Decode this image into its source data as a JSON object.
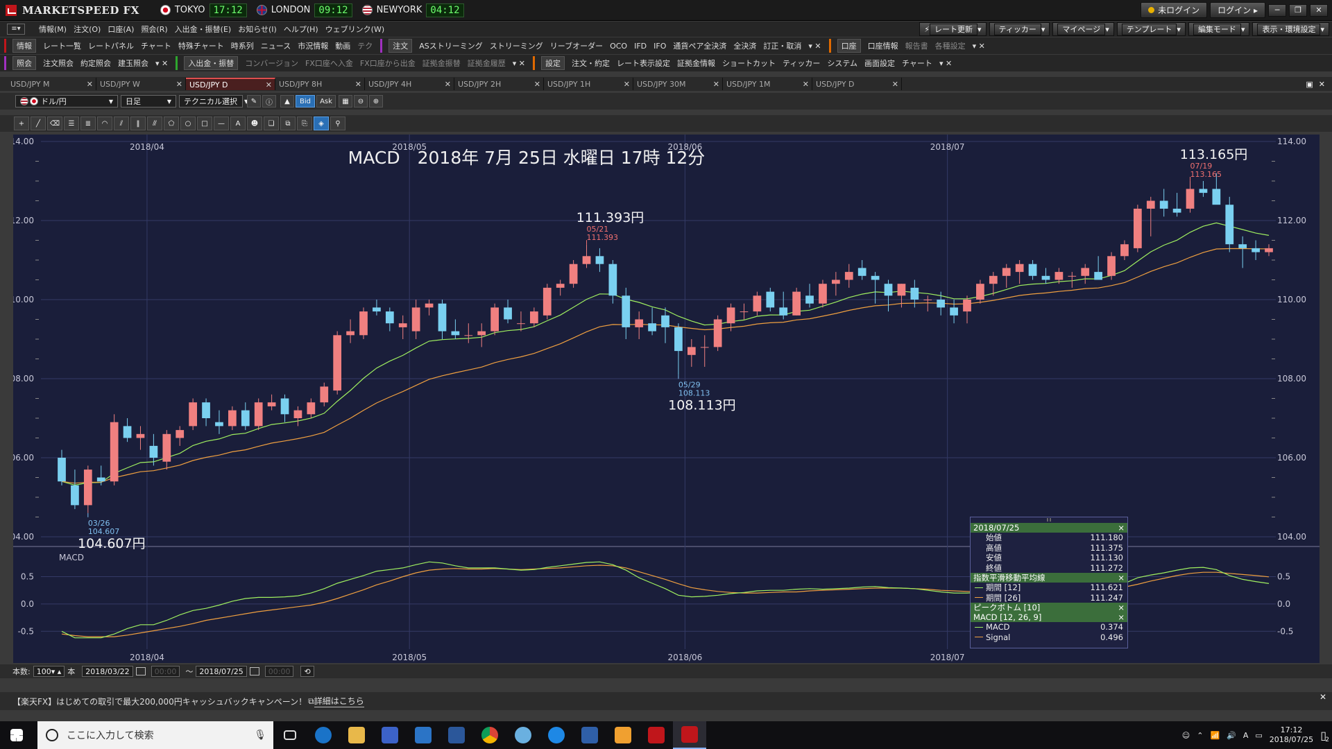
{
  "app": {
    "name": "MARKETSPEED FX",
    "clocks": [
      {
        "city": "TOKYO",
        "time": "17:12"
      },
      {
        "city": "LONDON",
        "time": "09:12"
      },
      {
        "city": "NEWYORK",
        "time": "04:12"
      }
    ],
    "login_status": "未ログイン",
    "login_button": "ログイン"
  },
  "menu": {
    "items": [
      "情報(M)",
      "注文(O)",
      "口座(A)",
      "照会(R)",
      "入出金・振替(E)",
      "お知らせ(I)",
      "ヘルプ(H)",
      "ウェブリンク(W)"
    ],
    "toolbar": [
      "レート更新",
      "ティッカー",
      "マイページ",
      "テンプレート",
      "編集モード",
      "表示・環境設定"
    ]
  },
  "quick1": {
    "info_head": "情報",
    "info": [
      "レート一覧",
      "レートパネル",
      "チャート",
      "特殊チャート",
      "時系列",
      "ニュース",
      "市況情報",
      "動画",
      "テク"
    ],
    "order_head": "注文",
    "order": [
      "ASストリーミング",
      "ストリーミング",
      "リーブオーダー",
      "OCO",
      "IFD",
      "IFO",
      "通貨ペア全決済",
      "全決済",
      "訂正・取消"
    ],
    "account_head": "口座",
    "account": [
      "口座情報",
      "報告書",
      "各種設定"
    ]
  },
  "quick2": {
    "inquiry_head": "照会",
    "inquiry": [
      "注文照会",
      "約定照会",
      "建玉照会"
    ],
    "transfer_head": "入出金・振替",
    "transfer": [
      "コンバージョン",
      "FX口座へ入金",
      "FX口座から出金",
      "証拠金振替",
      "証拠金履歴"
    ],
    "settings_head": "設定",
    "settings": [
      "注文・約定",
      "レート表示設定",
      "証拠金情報",
      "ショートカット",
      "ティッカー",
      "システム",
      "画面設定",
      "チャート"
    ]
  },
  "tabs": [
    "USD/JPY M",
    "USD/JPY W",
    "USD/JPY D",
    "USD/JPY 8H",
    "USD/JPY 4H",
    "USD/JPY 2H",
    "USD/JPY 1H",
    "USD/JPY 30M",
    "USD/JPY 1M",
    "USD/JPY D"
  ],
  "active_tab": 2,
  "chartbar": {
    "pair": "ドル/円",
    "period": "日足",
    "technical": "テクニカル選択",
    "bid": "Bid",
    "ask": "Ask"
  },
  "chart_data": {
    "type": "candlestick",
    "title": "MACD　2018年 7月 25日 水曜日 17時 12分",
    "y_ticks": [
      "104.00",
      "106.00",
      "108.00",
      "110.00",
      "112.00",
      "114.00"
    ],
    "ylim": [
      104,
      114
    ],
    "x_month_labels": [
      "2018/04",
      "2018/05",
      "2018/06",
      "2018/07"
    ],
    "month_start_index": [
      7,
      27,
      48,
      68
    ],
    "ohlc": [
      [
        106.0,
        106.2,
        105.3,
        105.4
      ],
      [
        105.3,
        105.7,
        104.7,
        104.8
      ],
      [
        104.8,
        105.8,
        104.6,
        105.7
      ],
      [
        105.5,
        105.8,
        105.3,
        105.4
      ],
      [
        105.4,
        107.1,
        105.3,
        106.9
      ],
      [
        106.8,
        107.0,
        106.4,
        106.5
      ],
      [
        106.5,
        106.8,
        106.2,
        106.6
      ],
      [
        106.3,
        106.6,
        105.8,
        106.0
      ],
      [
        105.9,
        106.7,
        105.7,
        106.6
      ],
      [
        106.5,
        106.8,
        106.3,
        106.7
      ],
      [
        106.8,
        107.5,
        106.7,
        107.4
      ],
      [
        107.4,
        107.5,
        106.8,
        107.0
      ],
      [
        106.9,
        107.2,
        106.6,
        106.8
      ],
      [
        106.8,
        107.3,
        106.7,
        107.2
      ],
      [
        107.2,
        107.4,
        106.7,
        106.8
      ],
      [
        106.8,
        107.5,
        106.7,
        107.4
      ],
      [
        107.3,
        107.6,
        107.2,
        107.4
      ],
      [
        107.5,
        107.6,
        106.9,
        107.1
      ],
      [
        107.0,
        107.3,
        106.8,
        107.2
      ],
      [
        107.1,
        107.5,
        107.0,
        107.4
      ],
      [
        107.4,
        107.9,
        107.3,
        107.8
      ],
      [
        107.7,
        109.2,
        107.6,
        109.1
      ],
      [
        109.1,
        109.5,
        108.9,
        109.2
      ],
      [
        109.1,
        109.8,
        109.0,
        109.7
      ],
      [
        109.8,
        110.0,
        109.6,
        109.7
      ],
      [
        109.7,
        109.8,
        109.2,
        109.4
      ],
      [
        109.3,
        109.6,
        109.0,
        109.4
      ],
      [
        109.2,
        110.0,
        109.0,
        109.8
      ],
      [
        109.8,
        110.0,
        109.6,
        109.9
      ],
      [
        109.9,
        110.0,
        109.0,
        109.2
      ],
      [
        109.2,
        109.5,
        109.0,
        109.1
      ],
      [
        109.1,
        109.4,
        108.9,
        109.1
      ],
      [
        109.1,
        109.4,
        108.8,
        109.2
      ],
      [
        109.2,
        109.9,
        109.1,
        109.8
      ],
      [
        109.8,
        110.0,
        109.4,
        109.5
      ],
      [
        109.4,
        109.7,
        109.2,
        109.4
      ],
      [
        109.4,
        109.8,
        109.3,
        109.7
      ],
      [
        109.6,
        110.4,
        109.5,
        110.3
      ],
      [
        110.3,
        110.5,
        110.1,
        110.4
      ],
      [
        110.4,
        111.0,
        110.3,
        110.9
      ],
      [
        110.9,
        111.4,
        110.8,
        111.1
      ],
      [
        111.1,
        111.3,
        110.7,
        110.9
      ],
      [
        110.9,
        111.0,
        109.9,
        110.1
      ],
      [
        110.1,
        110.3,
        109.0,
        109.3
      ],
      [
        109.3,
        109.7,
        109.0,
        109.5
      ],
      [
        109.4,
        109.8,
        109.1,
        109.2
      ],
      [
        109.6,
        109.8,
        108.9,
        109.3
      ],
      [
        109.3,
        109.4,
        108.1,
        108.7
      ],
      [
        108.6,
        109.0,
        108.3,
        108.8
      ],
      [
        108.8,
        109.1,
        108.3,
        108.8
      ],
      [
        108.8,
        109.6,
        108.7,
        109.5
      ],
      [
        109.4,
        109.9,
        109.2,
        109.8
      ],
      [
        109.7,
        109.9,
        109.5,
        109.7
      ],
      [
        109.7,
        110.2,
        109.6,
        110.1
      ],
      [
        110.2,
        110.3,
        109.7,
        109.8
      ],
      [
        109.8,
        110.2,
        109.5,
        109.6
      ],
      [
        109.6,
        110.3,
        109.6,
        110.2
      ],
      [
        110.1,
        110.4,
        109.8,
        109.9
      ],
      [
        109.9,
        110.5,
        109.8,
        110.4
      ],
      [
        110.4,
        110.7,
        110.1,
        110.5
      ],
      [
        110.5,
        110.9,
        110.3,
        110.7
      ],
      [
        110.8,
        111.0,
        110.5,
        110.6
      ],
      [
        110.6,
        110.7,
        109.9,
        110.5
      ],
      [
        110.4,
        110.5,
        109.7,
        110.1
      ],
      [
        110.1,
        110.4,
        109.8,
        110.4
      ],
      [
        110.3,
        110.5,
        109.8,
        110.0
      ],
      [
        110.0,
        110.1,
        109.7,
        110.0
      ],
      [
        110.0,
        110.2,
        109.6,
        109.8
      ],
      [
        109.8,
        110.0,
        109.4,
        109.6
      ],
      [
        109.7,
        110.1,
        109.4,
        110.0
      ],
      [
        110.0,
        110.5,
        109.9,
        110.4
      ],
      [
        110.4,
        110.7,
        110.1,
        110.6
      ],
      [
        110.6,
        110.9,
        110.3,
        110.8
      ],
      [
        110.7,
        111.0,
        110.4,
        110.9
      ],
      [
        110.9,
        111.0,
        110.5,
        110.6
      ],
      [
        110.6,
        110.8,
        110.4,
        110.5
      ],
      [
        110.5,
        110.8,
        110.4,
        110.7
      ],
      [
        110.6,
        110.7,
        110.3,
        110.6
      ],
      [
        110.6,
        110.9,
        110.4,
        110.8
      ],
      [
        110.7,
        111.1,
        110.5,
        110.5
      ],
      [
        110.6,
        111.2,
        110.5,
        111.1
      ],
      [
        111.1,
        111.5,
        111.0,
        111.4
      ],
      [
        111.3,
        112.4,
        111.2,
        112.3
      ],
      [
        112.3,
        112.6,
        111.6,
        112.5
      ],
      [
        112.5,
        112.8,
        112.1,
        112.3
      ],
      [
        112.3,
        112.7,
        112.1,
        112.2
      ],
      [
        112.3,
        113.0,
        112.2,
        112.8
      ],
      [
        112.8,
        113.0,
        112.6,
        112.7
      ],
      [
        112.8,
        113.2,
        112.6,
        112.4
      ],
      [
        112.4,
        112.6,
        111.2,
        111.4
      ],
      [
        111.4,
        111.6,
        110.8,
        111.3
      ],
      [
        111.3,
        111.5,
        111.0,
        111.2
      ],
      [
        111.2,
        111.4,
        111.1,
        111.3
      ]
    ],
    "ma_periods": [
      12,
      26
    ],
    "ma_colors": [
      "#a0f060",
      "#f0a040"
    ],
    "annotations": [
      {
        "type": "high",
        "index": 40,
        "date": "05/21",
        "value": "111.393",
        "label": "111.393円"
      },
      {
        "type": "low",
        "index": 47,
        "date": "05/29",
        "value": "108.113",
        "label": "108.113円"
      },
      {
        "type": "high",
        "index": 86,
        "date": "07/19",
        "value": "113.165",
        "label": "113.165円"
      },
      {
        "type": "low",
        "index": 2,
        "date": "03/26",
        "value": "104.607",
        "label": "104.607円"
      }
    ],
    "macd_panel": {
      "label": "MACD",
      "y_ticks": [
        "0.5",
        "0.0",
        "-0.5"
      ],
      "ylim": [
        -0.7,
        0.9
      ],
      "macd": [
        -0.5,
        -0.62,
        -0.62,
        -0.62,
        -0.55,
        -0.45,
        -0.38,
        -0.38,
        -0.3,
        -0.2,
        -0.12,
        -0.08,
        -0.02,
        0.05,
        0.1,
        0.12,
        0.12,
        0.13,
        0.15,
        0.2,
        0.28,
        0.38,
        0.45,
        0.52,
        0.6,
        0.63,
        0.66,
        0.72,
        0.77,
        0.75,
        0.7,
        0.66,
        0.66,
        0.66,
        0.64,
        0.62,
        0.63,
        0.67,
        0.7,
        0.73,
        0.76,
        0.77,
        0.72,
        0.62,
        0.48,
        0.38,
        0.28,
        0.16,
        0.13,
        0.14,
        0.16,
        0.19,
        0.21,
        0.24,
        0.25,
        0.25,
        0.27,
        0.28,
        0.27,
        0.28,
        0.29,
        0.31,
        0.32,
        0.3,
        0.29,
        0.28,
        0.25,
        0.22,
        0.2,
        0.2,
        0.21,
        0.23,
        0.24,
        0.26,
        0.26,
        0.25,
        0.25,
        0.24,
        0.25,
        0.27,
        0.31,
        0.38,
        0.48,
        0.53,
        0.57,
        0.62,
        0.66,
        0.67,
        0.63,
        0.52,
        0.45,
        0.41,
        0.374
      ],
      "signal": [
        -0.55,
        -0.58,
        -0.6,
        -0.6,
        -0.6,
        -0.57,
        -0.53,
        -0.49,
        -0.45,
        -0.41,
        -0.36,
        -0.3,
        -0.26,
        -0.22,
        -0.18,
        -0.14,
        -0.11,
        -0.08,
        -0.05,
        -0.02,
        0.03,
        0.1,
        0.18,
        0.26,
        0.35,
        0.42,
        0.5,
        0.57,
        0.62,
        0.64,
        0.65,
        0.64,
        0.64,
        0.65,
        0.64,
        0.63,
        0.64,
        0.65,
        0.66,
        0.68,
        0.7,
        0.71,
        0.7,
        0.66,
        0.59,
        0.52,
        0.45,
        0.37,
        0.3,
        0.26,
        0.23,
        0.21,
        0.2,
        0.2,
        0.21,
        0.22,
        0.22,
        0.24,
        0.25,
        0.26,
        0.27,
        0.28,
        0.29,
        0.29,
        0.29,
        0.28,
        0.27,
        0.25,
        0.24,
        0.23,
        0.22,
        0.22,
        0.22,
        0.23,
        0.23,
        0.23,
        0.24,
        0.24,
        0.25,
        0.26,
        0.28,
        0.31,
        0.36,
        0.42,
        0.47,
        0.52,
        0.56,
        0.58,
        0.58,
        0.56,
        0.54,
        0.52,
        0.496
      ],
      "colors": {
        "macd": "#a0f060",
        "signal": "#f0a040"
      }
    },
    "up_color": "#f08080",
    "down_color": "#7ad0f0"
  },
  "infobox": {
    "date": "2018/07/25",
    "ohlc": [
      {
        "label": "始値",
        "value": "111.180"
      },
      {
        "label": "高値",
        "value": "111.375"
      },
      {
        "label": "安値",
        "value": "111.130"
      },
      {
        "label": "終値",
        "value": "111.272"
      }
    ],
    "ema_title": "指数平滑移動平均線",
    "ema": [
      {
        "label": "期間 [12]",
        "value": "111.621"
      },
      {
        "label": "期間 [26]",
        "value": "111.247"
      }
    ],
    "peak_title": "ピークボトム [10]",
    "macd_title": "MACD [12, 26, 9]",
    "macd": [
      {
        "label": "MACD",
        "value": "0.374"
      },
      {
        "label": "Signal",
        "value": "0.496"
      }
    ]
  },
  "bottombar": {
    "count_label": "本数:",
    "count": "100",
    "unit": "本",
    "start_date": "2018/03/22",
    "start_time": "00:00",
    "tilde": "～",
    "end_date": "2018/07/25",
    "end_time": "00:00"
  },
  "promo": {
    "text": "【楽天FX】はじめての取引で最大200,000円キャッシュバックキャンペーン！",
    "link": "詳細はこちら"
  },
  "taskbar": {
    "search_placeholder": "ここに入力して検索",
    "time": "17:12",
    "date": "2018/07/25",
    "notif": "2"
  }
}
